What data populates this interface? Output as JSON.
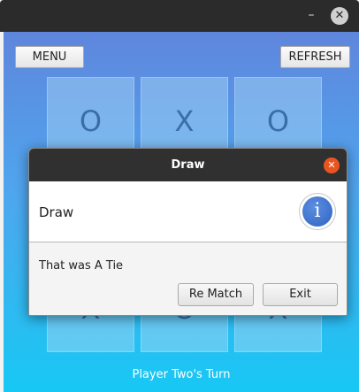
{
  "window": {
    "minimize_glyph": "–",
    "close_glyph": "✕"
  },
  "toolbar": {
    "menu_label": "MENU",
    "refresh_label": "REFRESH"
  },
  "board": {
    "cells": [
      "O",
      "X",
      "O",
      "",
      "",
      "",
      "X",
      "O",
      "X"
    ]
  },
  "status": {
    "text": "Player Two's Turn"
  },
  "dialog": {
    "title": "Draw",
    "close_glyph": "✕",
    "heading": "Draw",
    "info_glyph": "i",
    "message": "That was A Tie",
    "rematch_label": "Re Match",
    "exit_label": "Exit"
  },
  "colors": {
    "gradient_top": "#5f86dd",
    "gradient_bottom": "#17c8f4",
    "dialog_close": "#e95420",
    "info_blue": "#2f63c1"
  }
}
